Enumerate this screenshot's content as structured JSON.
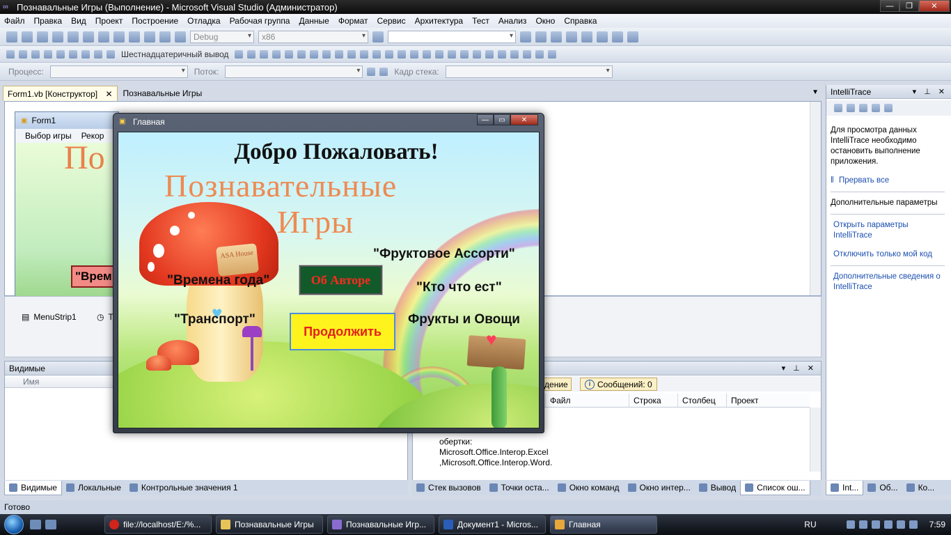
{
  "window": {
    "title": "Познавальные Игры (Выполнение) - Microsoft Visual Studio (Администратор)"
  },
  "menu": [
    "Файл",
    "Правка",
    "Вид",
    "Проект",
    "Построение",
    "Отладка",
    "Рабочая группа",
    "Данные",
    "Формат",
    "Сервис",
    "Архитектура",
    "Тест",
    "Анализ",
    "Окно",
    "Справка"
  ],
  "toolbar": {
    "config": "Debug",
    "platform": "x86",
    "hex_output": "Шестнадцатеричный вывод",
    "process_label": "Процесс:",
    "thread_label": "Поток:",
    "stackframe_label": "Кадр стека:"
  },
  "doc_tabs": [
    {
      "label": "Form1.vb [Конструктор]",
      "close": "✕"
    },
    {
      "label": "Познавальные Игры"
    }
  ],
  "designer": {
    "form_caption": "Form1",
    "menu_items": [
      "Выбор игры",
      "Рекор"
    ],
    "bg_title": "По",
    "vremena_partial": "\"Врем"
  },
  "component_tray": [
    "MenuStrip1",
    "T"
  ],
  "intellitrace": {
    "title": "IntelliTrace",
    "message": "Для просмотра данных IntelliTrace необходимо остановить выполнение приложения.",
    "break_all": "Прервать все",
    "additional_params": "Дополнительные параметры",
    "open_params": "Открыть параметры IntelliTrace",
    "disable_my_code": "Отключить только мой код",
    "more_info": "Дополнительные сведения о IntelliTrace"
  },
  "locals_panel": {
    "title": "Видимые",
    "col_name": "Имя"
  },
  "error_list": {
    "warn_partial": "ждение",
    "messages": "Сообщений: 0",
    "columns": [
      "Файл",
      "Строка",
      "Столбец",
      "Проект"
    ],
    "text": "обертки: Microsoft.Office.Interop.Excel ,Microsoft.Office.Interop.Word."
  },
  "bottom_tabs_left": [
    "Видимые",
    "Локальные",
    "Контрольные значения 1"
  ],
  "bottom_tabs_right": [
    "Стек вызовов",
    "Точки оста...",
    "Окно команд",
    "Окно интер...",
    "Вывод",
    "Список ош..."
  ],
  "bottom_tabs_far": [
    "Int...",
    "Об...",
    "Ко..."
  ],
  "status": "Готово",
  "app_form": {
    "caption": "Главная",
    "welcome": "Добро Пожаловать!",
    "title_line1": "Познавательные",
    "title_line2": "Игры",
    "fruit_assorti": "\"Фруктовое Ассорти\"",
    "seasons": "\"Времена года\"",
    "who_eats": "\"Кто что ест\"",
    "transport": "\"Транспорт\"",
    "fruits_veg": "Фрукты и Овощи",
    "about_btn": "Об Авторе",
    "continue_btn": "Продолжить",
    "sign_text": "ASA House"
  },
  "taskbar": {
    "items": [
      "file://localhost/E:/%...",
      "Познавальные Игры",
      "Познавальные Игр...",
      "Документ1 - Micros...",
      "Главная"
    ],
    "lang": "RU",
    "time": "7:59"
  }
}
